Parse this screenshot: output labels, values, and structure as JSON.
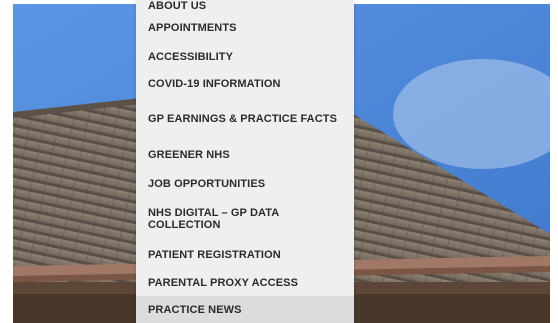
{
  "menu": {
    "items": [
      {
        "label": "ABOUT US"
      },
      {
        "label": "APPOINTMENTS"
      },
      {
        "label": "ACCESSIBILITY"
      },
      {
        "label": "COVID-19 INFORMATION"
      },
      {
        "label": "GP EARNINGS & PRACTICE FACTS"
      },
      {
        "label": "GREENER NHS"
      },
      {
        "label": "JOB OPPORTUNITIES"
      },
      {
        "label": "NHS DIGITAL – GP DATA COLLECTION"
      },
      {
        "label": "PATIENT REGISTRATION"
      },
      {
        "label": "PARENTAL PROXY ACCESS"
      },
      {
        "label": "PRACTICE NEWS",
        "active": true
      }
    ]
  },
  "colors": {
    "sky": "#4d86d8",
    "roof": "#7d7163",
    "gutter": "#9a6b56",
    "menu_bg": "#efefef",
    "menu_text": "#2b2b2b",
    "active_bg": "#dcdcdc"
  },
  "hero": {
    "image": "roof-photo"
  }
}
